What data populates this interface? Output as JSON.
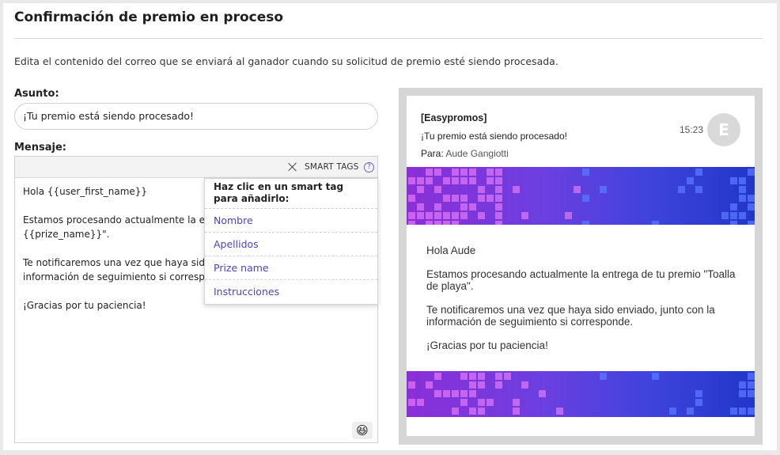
{
  "header": {
    "title": "Confirmación de premio en proceso",
    "description": "Edita el contenido del correo que se enviará al ganador cuando su solicitud de premio esté siendo procesada."
  },
  "form": {
    "subject_label": "Asunto:",
    "subject_value": "¡Tu premio está siendo procesado!",
    "message_label": "Mensaje:",
    "toolbar": {
      "smart_tags_label": "SMART TAGS",
      "help_glyph": "?"
    },
    "message_lines": [
      "Hola {{user_first_name}}",
      "Estamos procesando actualmente la en",
      "{{prize_name}}\".",
      "Te notificaremos una vez que haya sido",
      "información de seguimiento si correspo",
      "¡Gracias por tu paciencia!"
    ],
    "emoji_glyph": "😆"
  },
  "smart_tags_dropdown": {
    "heading": "Haz clic en un smart tag para añadirlo:",
    "items": [
      "Nombre",
      "Apellidos",
      "Prize name",
      "Instrucciones"
    ]
  },
  "preview": {
    "sender": "[Easypromos]",
    "subject": "¡Tu premio está siendo procesado!",
    "to_label": "Para:",
    "to_value": "Aude Gangiotti",
    "time": "15:23",
    "avatar_letter": "E",
    "body": [
      "Hola Aude",
      "Estamos procesando actualmente la entrega de tu premio \"Toalla de playa\".",
      "Te notificaremos una vez que haya sido enviado, junto con la información de seguimiento si corresponde.",
      "¡Gracias por tu paciencia!"
    ]
  },
  "colors": {
    "link": "#4b44b8",
    "banner_left": "#8b2fd7",
    "banner_right": "#2136c9",
    "accent_help": "#6a63c7"
  },
  "icons": [
    "close-icon",
    "help-icon",
    "emoji-icon"
  ]
}
